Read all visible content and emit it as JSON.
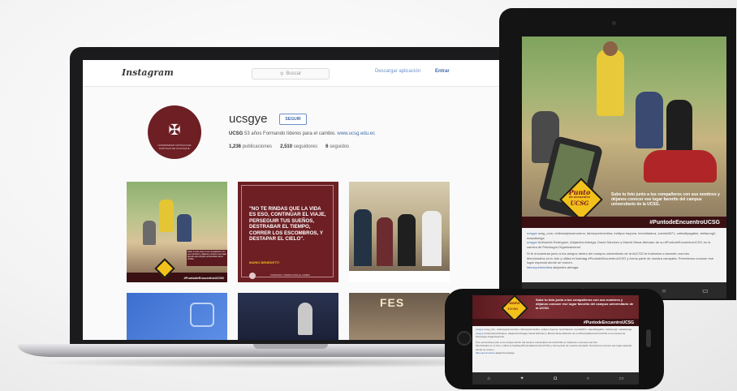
{
  "instagram": {
    "logo": "Instagram",
    "search_placeholder": "Buscar",
    "download_app": "Descargar aplicación",
    "login": "Entrar",
    "username": "ucsgye",
    "follow": "SEGUIR",
    "bio_name": "UCSG",
    "bio_text": "53 años Formando líderes para el cambio.",
    "bio_link": "www.ucsg.edu.ec",
    "posts_count": "1,236",
    "posts_label": "publicaciones",
    "followers_count": "2,510",
    "followers_label": "seguidores",
    "following_count": "6",
    "following_label": "seguidos",
    "avatar_text": "UNIVERSIDAD CATÓLICA DE SANTIAGO DE GUAYAQUIL",
    "quote_post": {
      "text": "\"NO TE RINDAS QUE LA VIDA ES ESO, CONTINUAR EL VIAJE, PERSEGUIR TUS SUEÑOS, DESTRABAR EL TIEMPO, CORRER LOS ESCOMBROS, Y DESTAPAR EL CIELO\".",
      "author": "MARIO BENEDETTI",
      "footer": "FORMANDO LÍDERES PARA EL CAMBIO"
    },
    "post1_hashtag": "#PuntodeEncuentroUCSG",
    "post1_caption": "Sube tu foto junto a tus compañeros con sus nombres y déjanos conocer ese lugar favorito del campus universitario de la UCSG.",
    "post7_text": "FES"
  },
  "campaign": {
    "badge_line1": "Punto",
    "badge_line2": "de encuentro",
    "badge_line3": "UCSG",
    "caption": "Sube tu foto junto a tus compañeros con sus nombres y déjanos conocer ese lugar favorito del campus universitario de la UCSG.",
    "hashtag": "#PuntodeEncuentroUCSG",
    "comment1_user": "ucsgye",
    "comment1_text": "ucsg_com, nellessejesusmoreno, fabrouperimedina, estilyuc bayona, tenchitalarra, cuenta0671, valerallyagabio, stefanorg2, masaltoniga",
    "comment2_user": "ucsgye",
    "comment2_text": "Anthonela Rodríguez, Alejandra Arteaga, David Sánchez y Marcel Mesa disfrutan de su #PuntodeEncuentroUCSG en la carrera de Psicología Organizacional.",
    "comment3_text": "Si te encuentras junto a tus amigos dentro del campus universitario de la #UCSG te invitamos a tomarte una foto.",
    "comment4_text": "Menciónalos en tu foto y utiliza el hashtag #PuntodeEncuentroUCSG y forma parte de nuestra campaña. Permítenos conocer ese lugar especial donde se reúnen.",
    "comment5_user": "fabrouperimedina",
    "comment5_text": "alejandra arteaga"
  },
  "tabbar": {
    "home_icon": "⌂",
    "explore_icon": "✦",
    "camera_icon": "◘",
    "activity_icon": "○",
    "profile_icon": "▭"
  },
  "colors": {
    "brand_maroon": "#6d1f24",
    "badge_yellow": "#f2c11b",
    "ig_link_blue": "#3f6aa8"
  }
}
